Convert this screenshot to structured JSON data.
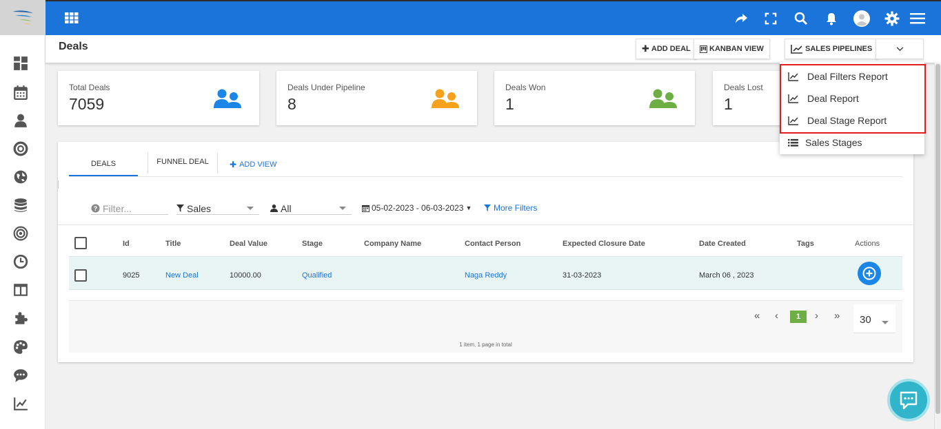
{
  "header": {
    "page_title": "Deals",
    "add_deal_label": "ADD DEAL",
    "kanban_view_label": "KANBAN VIEW",
    "sales_pipelines_label": "SALES PIPELINES"
  },
  "stats": [
    {
      "label": "Total Deals",
      "value": "7059",
      "icon_color": "#1b86e8"
    },
    {
      "label": "Deals Under Pipeline",
      "value": "8",
      "icon_color": "#f4a21b"
    },
    {
      "label": "Deals Won",
      "value": "1",
      "icon_color": "#6dae45"
    },
    {
      "label": "Deals Lost",
      "value": "1",
      "icon_color": "#e53935"
    }
  ],
  "tabs": {
    "deals": "DEALS",
    "funnel_deal": "FUNNEL DEAL",
    "add_view": "ADD VIEW"
  },
  "filters": {
    "search_placeholder": "Filter...",
    "pipeline": "Sales",
    "owner": "All",
    "date_range": "05-02-2023 - 06-03-2023",
    "more_filters": "More Filters"
  },
  "table": {
    "columns": [
      "Id",
      "Title",
      "Deal Value",
      "Stage",
      "Company Name",
      "Contact Person",
      "Expected Closure Date",
      "Date Created",
      "Tags",
      "Actions"
    ],
    "rows": [
      {
        "id": "9025",
        "title": "New Deal",
        "deal_value": "10000.00",
        "stage": "Qualified",
        "company_name": "",
        "contact_person": "Naga Reddy",
        "expected_closure_date": "31-03-2023",
        "date_created": "March 06 , 2023",
        "tags": ""
      }
    ]
  },
  "pagination": {
    "current_page": "1",
    "page_size": "30",
    "info": "1 item, 1 page in total"
  },
  "dropdown": {
    "items": [
      "Deal Filters Report",
      "Deal Report",
      "Deal Stage Report",
      "Sales Stages"
    ]
  },
  "colors": {
    "primary": "#1b74d9",
    "highlight_border": "#e31b1b",
    "row_background": "#e9f5f5",
    "active_page": "#6dae45",
    "chat": "#30b5cb"
  }
}
